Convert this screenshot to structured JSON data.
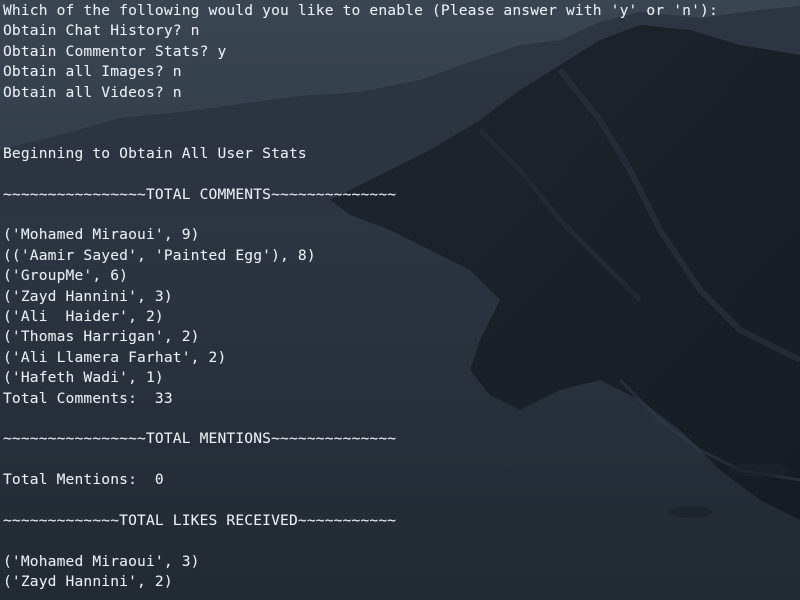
{
  "colors": {
    "text": "#e9edf2",
    "background": "#2b3440"
  },
  "terminal": {
    "lines": [
      "Which of the following would you like to enable (Please answer with 'y' or 'n'):",
      "Obtain Chat History? n",
      "Obtain Commentor Stats? y",
      "Obtain all Images? n",
      "Obtain all Videos? n",
      "",
      "",
      "Beginning to Obtain All User Stats",
      "",
      "~~~~~~~~~~~~~~~~TOTAL COMMENTS~~~~~~~~~~~~~~",
      "",
      "('Mohamed Miraoui', 9)",
      "(('Aamir Sayed', 'Painted Egg'), 8)",
      "('GroupMe', 6)",
      "('Zayd Hannini', 3)",
      "('Ali  Haider', 2)",
      "('Thomas Harrigan', 2)",
      "('Ali Llamera Farhat', 2)",
      "('Hafeth Wadi', 1)",
      "Total Comments:  33",
      "",
      "~~~~~~~~~~~~~~~~TOTAL MENTIONS~~~~~~~~~~~~~~",
      "",
      "Total Mentions:  0",
      "",
      "~~~~~~~~~~~~~TOTAL LIKES RECEIVED~~~~~~~~~~~",
      "",
      "('Mohamed Miraoui', 3)",
      "('Zayd Hannini', 2)"
    ]
  }
}
